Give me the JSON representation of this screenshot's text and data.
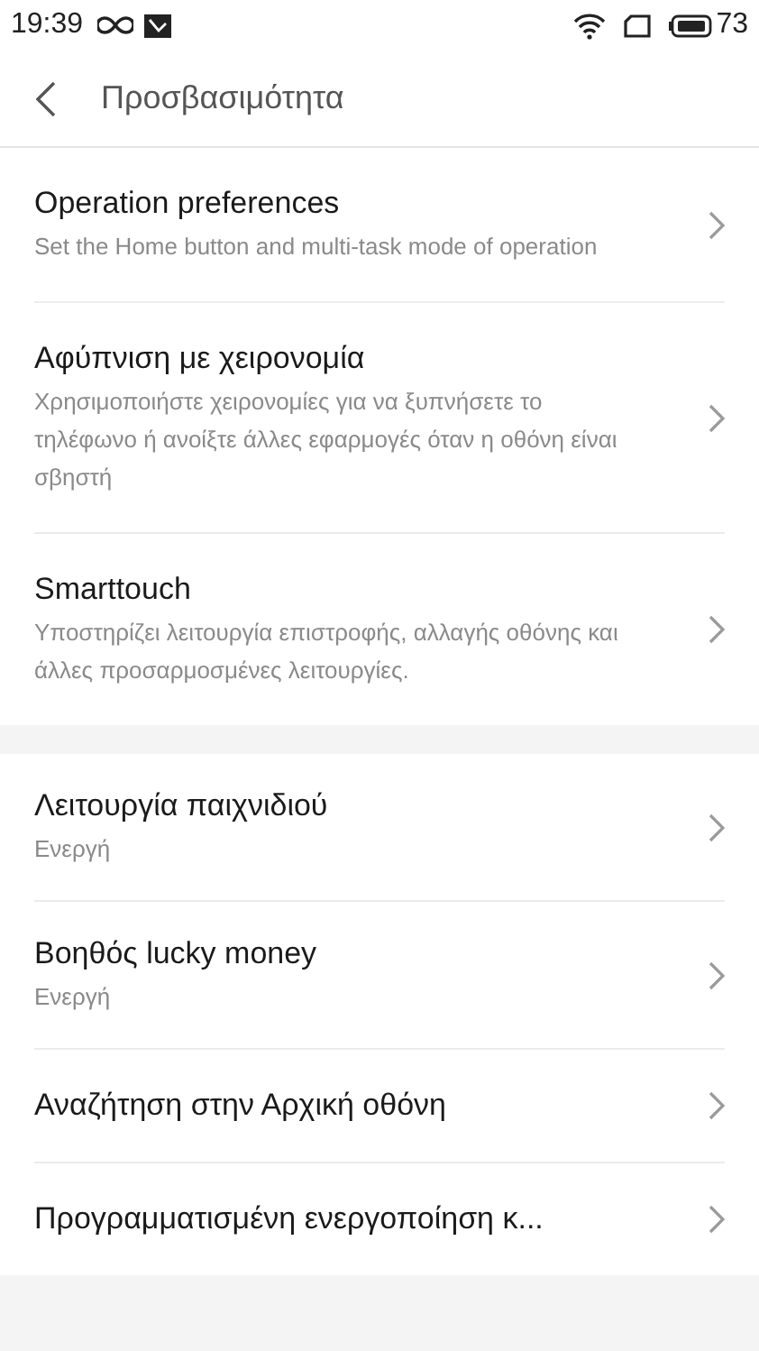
{
  "status_bar": {
    "time": "19:39",
    "battery": "73"
  },
  "header": {
    "title": "Προσβασιμότητα"
  },
  "sections": [
    {
      "items": [
        {
          "title": "Operation preferences",
          "subtitle": "Set the Home button and multi-task mode of operation"
        },
        {
          "title": "Αφύπνιση με χειρονομία",
          "subtitle": "Χρησιμοποιήστε χειρονομίες για να ξυπνήσετε το τηλέφωνο ή ανοίξτε άλλες εφαρμογές όταν η οθόνη είναι σβηστή"
        },
        {
          "title": "Smarttouch",
          "subtitle": "Υποστηρίζει λειτουργία επιστροφής, αλλαγής οθόνης και άλλες προσαρμοσμένες λειτουργίες."
        }
      ]
    },
    {
      "items": [
        {
          "title": "Λειτουργία παιχνιδιού",
          "subtitle": "Ενεργή"
        },
        {
          "title": "Βοηθός lucky money",
          "subtitle": "Ενεργή"
        },
        {
          "title": "Αναζήτηση στην Αρχική οθόνη"
        },
        {
          "title": "Προγραμματισμένη ενεργοποίηση κ..."
        }
      ]
    }
  ]
}
